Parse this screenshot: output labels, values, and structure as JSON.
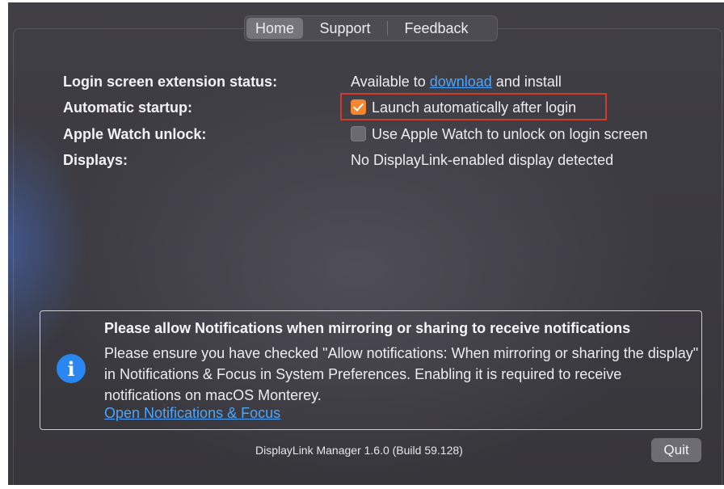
{
  "tabs": {
    "home": "Home",
    "support": "Support",
    "feedback": "Feedback",
    "selected": "Home"
  },
  "rows": {
    "login_extension": {
      "label": "Login screen extension status:",
      "value_prefix": "Available to ",
      "link": "download",
      "value_suffix": " and install"
    },
    "automatic_startup": {
      "label": "Automatic startup:",
      "checkbox_label": "Launch automatically after login",
      "checked": true
    },
    "apple_watch": {
      "label": "Apple Watch unlock:",
      "checkbox_label": "Use Apple Watch to unlock on login screen",
      "checked": false
    },
    "displays": {
      "label": "Displays:",
      "value": "No DisplayLink-enabled display detected"
    }
  },
  "notice": {
    "icon": "info-icon",
    "title": "Please allow Notifications when mirroring or sharing to receive notifications",
    "body": "Please ensure you have checked \"Allow notifications: When mirroring or sharing the display\" in Notifications & Focus in System Preferences. Enabling it is required to receive notifications on macOS Monterey.",
    "link": "Open Notifications & Focus"
  },
  "footer": {
    "version": "DisplayLink Manager 1.6.0 (Build 59.128)",
    "quit": "Quit"
  },
  "colors": {
    "accent_checkbox": "#f5862b",
    "link": "#4ca6ff",
    "info_icon": "#2a86f0",
    "highlight_box": "#d43a2c"
  }
}
